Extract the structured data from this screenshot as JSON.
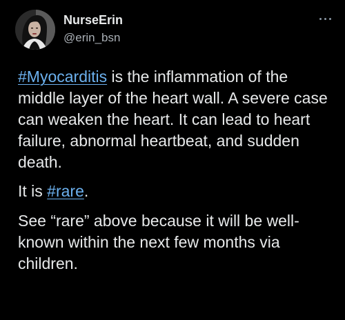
{
  "author": {
    "display_name": "NurseErin",
    "handle": "@erin_bsn"
  },
  "menu": {
    "icon": "more-horizontal-icon"
  },
  "tweet": {
    "hashtag_1": "#Myocarditis",
    "paragraph_1_rest": " is the inflammation of the middle layer of the heart wall. A severe case can weaken the heart. It can lead to heart failure, abnormal heartbeat, and sudden death.",
    "paragraph_2_prefix": "It is ",
    "hashtag_2": "#rare",
    "paragraph_2_suffix": ".",
    "paragraph_3": "See “rare” above because it will be well-known within the next few months via children."
  },
  "colors": {
    "background": "#000000",
    "text": "#e7e9ea",
    "secondary_text": "#aab0b6",
    "link": "#6cb1ef"
  }
}
